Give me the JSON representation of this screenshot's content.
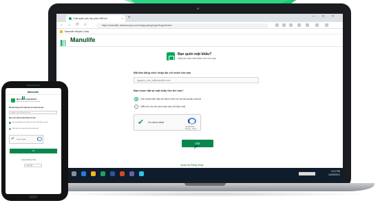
{
  "browser": {
    "tab_title": "Chia quên yêu lây phen đổi hơi",
    "new_tab": "+",
    "window_controls": [
      "–",
      "□",
      "×"
    ],
    "nav": [
      "←",
      "→",
      "⟳",
      "⌂"
    ],
    "url": "https://manulife-vietnamsoly.com/mlsiguo/ping/login/forgot/Index",
    "bookmark": "Manulife Helpful Links"
  },
  "header": {
    "logo_text": "Manulife"
  },
  "page": {
    "title": "Bạn quên mật khẩu?",
    "subtitle": "Hãy tạo mật mật khẩu mới cho bạn",
    "identify_label": "Bắt đầu bằng cách nhập địa chỉ email của bạn",
    "email_value": "nguyen_van_a@manulife.com",
    "method_label": "Bạn muốn đặt lại mật khẩu thư thế nào?",
    "options": [
      {
        "label": "Gửi email đến địa chỉ được kết nối với tài khoản của tôi",
        "selected": true
      },
      {
        "label": "Hiển thị cho tôi xem một câu hỏi bảo mật",
        "selected": false
      }
    ],
    "captcha": {
      "label": "I'm not a robot",
      "footer": "reCAPTCHA · Privacy - Terms"
    },
    "send_button": "Gửi",
    "back_link": "Quay lại Đăng nhập"
  },
  "taskbar": {
    "clock": "5:41 PM",
    "date": "10/26/2021"
  },
  "phone": {
    "logo_text": "Manulife",
    "title": "Bạn quên mật khẩu?",
    "subtitle": "Hãy tạo mật mật khẩu mới cho bạn",
    "identify_label": "Bắt đầu bằng cách nhập địa chỉ email của bạn",
    "email_value": "nguyen_van_a@manulife.com",
    "method_label": "Bạn muốn đặt lại mật khẩu thế nào?",
    "option1": "Gửi email đến địa chỉ được kết nối với tài khoản của tôi",
    "option2": "Hiển thị cho tôi xem một câu hỏi bảo mật",
    "captcha_label": "I'm not a robot",
    "send_button": "Gửi",
    "back_link": "Quay lại Đăng nhập",
    "language": "Tiếng Việt"
  },
  "colors": {
    "brand_green": "#00a758",
    "button_green": "#06874e",
    "taskbar": "#0f1c2c",
    "background_accent": "#00c46a"
  }
}
